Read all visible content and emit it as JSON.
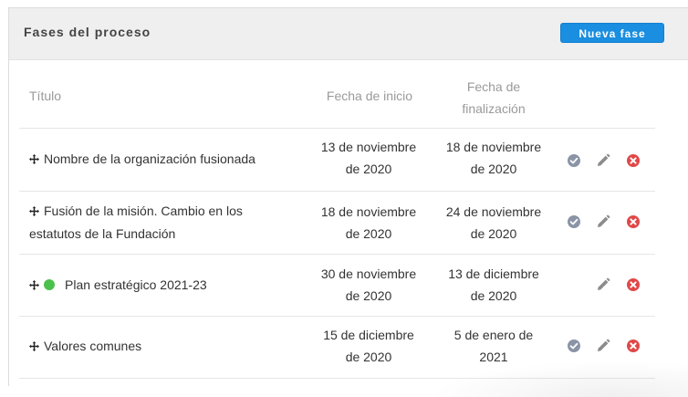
{
  "panel": {
    "title": "Fases del proceso",
    "new_button_label": "Nueva fase"
  },
  "table": {
    "headers": {
      "title": "Título",
      "start_date": "Fecha de inicio",
      "end_date_line1": "Fecha de",
      "end_date_line2": "finalización"
    },
    "rows": [
      {
        "title_line1": "Nombre de la organización fusionada",
        "title_line2": "",
        "start_line1": "13 de noviembre",
        "start_line2": "de 2020",
        "end_line1": "18 de noviembre",
        "end_line2": "de 2020",
        "active": false,
        "has_check": true
      },
      {
        "title_line1": "Fusión de la misión. Cambio en los",
        "title_line2": "estatutos de la Fundación",
        "start_line1": "18 de noviembre",
        "start_line2": "de 2020",
        "end_line1": "24 de noviembre",
        "end_line2": "de 2020",
        "active": false,
        "has_check": true
      },
      {
        "title_line1": "Plan estratégico 2021-23",
        "title_line2": "",
        "start_line1": "30 de noviembre",
        "start_line2": "de 2020",
        "end_line1": "13 de diciembre",
        "end_line2": "de 2020",
        "active": true,
        "has_check": false
      },
      {
        "title_line1": "Valores comunes",
        "title_line2": "",
        "start_line1": "15 de diciembre",
        "start_line2": "de 2020",
        "end_line1": "5 de enero de",
        "end_line2": "2021",
        "active": false,
        "has_check": true
      }
    ]
  },
  "icons": {
    "move": "move-arrows-icon",
    "active_status": "green-dot-icon",
    "complete": "check-circle-icon",
    "edit": "pencil-icon",
    "delete": "close-circle-icon"
  },
  "colors": {
    "primary_button": "#1a8ee0",
    "active_dot": "#4cc04c",
    "check_icon": "#8a94a6",
    "edit_icon": "#8c8c8c",
    "delete_icon": "#e04848",
    "header_bg": "#efefef"
  }
}
